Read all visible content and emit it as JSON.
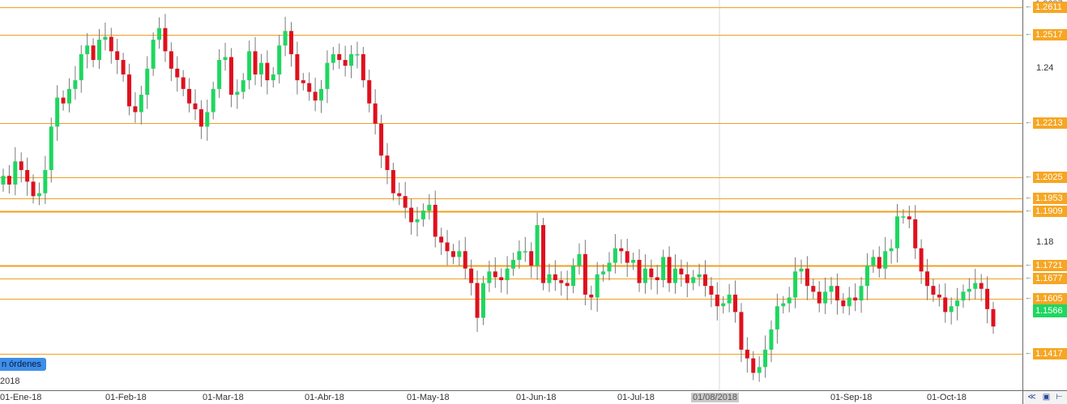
{
  "chart_data": {
    "type": "candlestick",
    "instrument_last_price": "1.1566",
    "y_ticks": [
      "1.24",
      "1.18"
    ],
    "ylim": [
      1.129,
      1.2637
    ],
    "top_price": "1.2637",
    "x_ticks": [
      "01-Ene-18",
      "01-Feb-18",
      "01-Mar-18",
      "01-Abr-18",
      "01-May-18",
      "01-Jun-18",
      "01-Jul-18",
      "01/08/2018",
      "01-Sep-18",
      "01-Oct-18"
    ],
    "x_tick_highlighted": "01/08/2018",
    "levels": [
      {
        "price": 1.2611,
        "label": "1.2611"
      },
      {
        "price": 1.2517,
        "label": "1.2517"
      },
      {
        "price": 1.2213,
        "label": "1.2213"
      },
      {
        "price": 1.2025,
        "label": "1.2025"
      },
      {
        "price": 1.1953,
        "label": "1.1953"
      },
      {
        "price": 1.1909,
        "label": "1.1909"
      },
      {
        "price": 1.1721,
        "label": "1.1721"
      },
      {
        "price": 1.1677,
        "label": "1.1677"
      },
      {
        "price": 1.1605,
        "label": "1.1605"
      },
      {
        "price": 1.1417,
        "label": "1.1417"
      }
    ],
    "closes": [
      1.203,
      1.2,
      1.208,
      1.205,
      1.201,
      1.196,
      1.197,
      1.205,
      1.22,
      1.23,
      1.228,
      1.233,
      1.236,
      1.245,
      1.248,
      1.243,
      1.25,
      1.251,
      1.246,
      1.243,
      1.238,
      1.227,
      1.225,
      1.231,
      1.24,
      1.25,
      1.254,
      1.246,
      1.24,
      1.237,
      1.233,
      1.228,
      1.226,
      1.22,
      1.225,
      1.233,
      1.243,
      1.244,
      1.231,
      1.232,
      1.236,
      1.246,
      1.238,
      1.242,
      1.236,
      1.238,
      1.248,
      1.253,
      1.245,
      1.236,
      1.235,
      1.232,
      1.229,
      1.233,
      1.242,
      1.245,
      1.243,
      1.241,
      1.245,
      1.245,
      1.236,
      1.228,
      1.221,
      1.21,
      1.205,
      1.197,
      1.196,
      1.192,
      1.187,
      1.188,
      1.191,
      1.193,
      1.182,
      1.18,
      1.177,
      1.175,
      1.177,
      1.171,
      1.166,
      1.154,
      1.166,
      1.17,
      1.168,
      1.167,
      1.171,
      1.174,
      1.177,
      1.177,
      1.172,
      1.186,
      1.166,
      1.169,
      1.167,
      1.166,
      1.165,
      1.172,
      1.176,
      1.162,
      1.161,
      1.169,
      1.17,
      1.173,
      1.178,
      1.177,
      1.173,
      1.174,
      1.166,
      1.171,
      1.168,
      1.167,
      1.175,
      1.166,
      1.171,
      1.169,
      1.166,
      1.168,
      1.169,
      1.165,
      1.162,
      1.158,
      1.159,
      1.162,
      1.156,
      1.143,
      1.14,
      1.135,
      1.137,
      1.143,
      1.15,
      1.158,
      1.159,
      1.161,
      1.17,
      1.171,
      1.165,
      1.163,
      1.159,
      1.163,
      1.165,
      1.16,
      1.158,
      1.161,
      1.16,
      1.165,
      1.172,
      1.175,
      1.171,
      1.177,
      1.178,
      1.189,
      1.189,
      1.188,
      1.178,
      1.17,
      1.165,
      1.162,
      1.161,
      1.156,
      1.158,
      1.16,
      1.163,
      1.164,
      1.166,
      1.164,
      1.157,
      1.151
    ]
  },
  "ui": {
    "orders_badge": "n órdenes",
    "year_label": "2018",
    "corner_btn_a": "≪",
    "corner_btn_b": "▣",
    "corner_btn_c": "⊢"
  },
  "colors": {
    "up": "#1ed760",
    "down": "#e0101e",
    "wick": "#7a7a7a",
    "level": "#f0a020",
    "tag": "#f6a623",
    "last": "#1ed760"
  }
}
